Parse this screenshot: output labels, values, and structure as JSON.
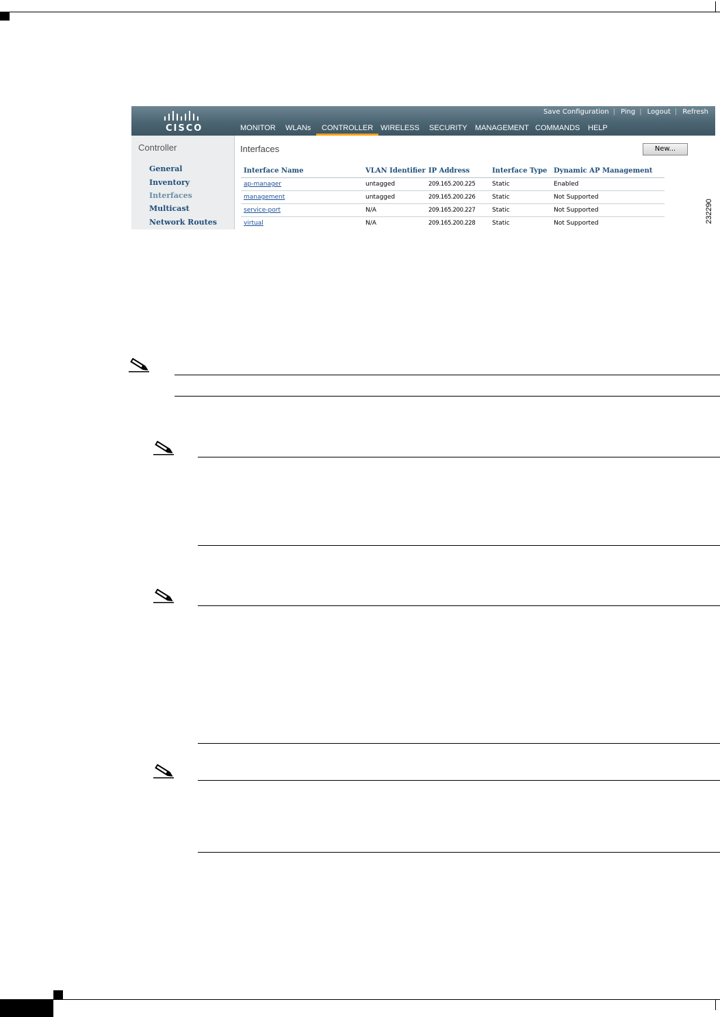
{
  "screenshot": {
    "brand": "CISCO",
    "top_links": [
      "Save Configuration",
      "Ping",
      "Logout",
      "Refresh"
    ],
    "nav": [
      "MONITOR",
      "WLANs",
      "CONTROLLER",
      "WIRELESS",
      "SECURITY",
      "MANAGEMENT",
      "COMMANDS",
      "HELP"
    ],
    "active_nav": "CONTROLLER",
    "sidebar_title": "Controller",
    "sidebar_items": [
      "General",
      "Inventory",
      "Interfaces",
      "Multicast",
      "Network Routes"
    ],
    "page_title": "Interfaces",
    "new_button": "New...",
    "table": {
      "headers": [
        "Interface Name",
        "VLAN Identifier",
        "IP Address",
        "Interface Type",
        "Dynamic AP Management"
      ],
      "rows": [
        [
          "ap-manager",
          "untagged",
          "209.165.200.225",
          "Static",
          "Enabled"
        ],
        [
          "management",
          "untagged",
          "209.165.200.226",
          "Static",
          "Not Supported"
        ],
        [
          "service-port",
          "N/A",
          "209.165.200.227",
          "Static",
          "Not Supported"
        ],
        [
          "virtual",
          "N/A",
          "209.165.200.228",
          "Static",
          "Not Supported"
        ]
      ]
    },
    "figure_id": "232290"
  },
  "icons": {
    "note": "pencil-note-icon"
  }
}
